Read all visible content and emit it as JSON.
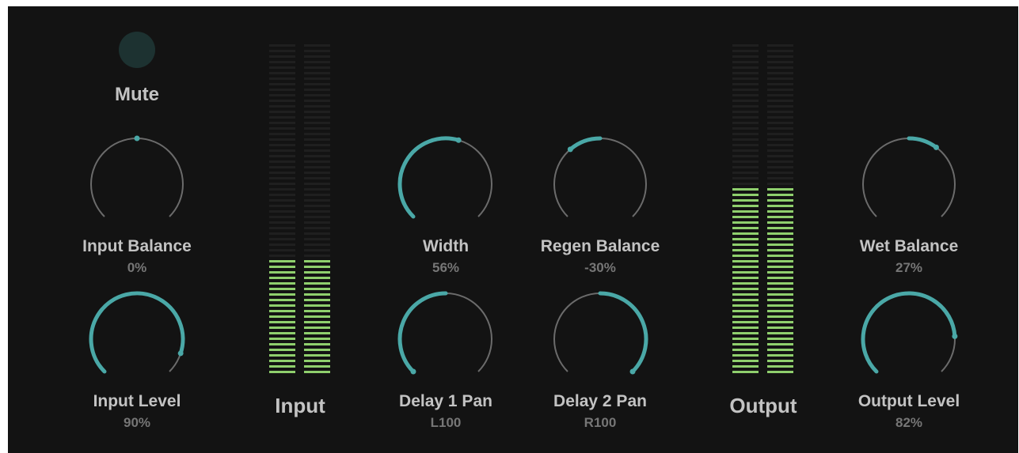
{
  "accent": "#4aa8a7",
  "track": "#6b6b6b",
  "meter_on": "#8fcf6d",
  "meter_off": "#1f1f1f",
  "mute": {
    "label": "Mute"
  },
  "meters": {
    "input": {
      "label": "Input",
      "level": 0.35
    },
    "output": {
      "label": "Output",
      "level": 0.56
    }
  },
  "knobs": [
    {
      "id": "input-balance",
      "label": "Input Balance",
      "value": "0%",
      "mode": "bipolar",
      "amount": 0.0
    },
    {
      "id": "input-level",
      "label": "Input Level",
      "value": "90%",
      "mode": "unipolar",
      "amount": 0.9
    },
    {
      "id": "width",
      "label": "Width",
      "value": "56%",
      "mode": "unipolar",
      "amount": 0.56
    },
    {
      "id": "regen-balance",
      "label": "Regen Balance",
      "value": "-30%",
      "mode": "bipolar",
      "amount": -0.3
    },
    {
      "id": "delay-1-pan",
      "label": "Delay 1 Pan",
      "value": "L100",
      "mode": "bipolar",
      "amount": -1.0
    },
    {
      "id": "delay-2-pan",
      "label": "Delay 2 Pan",
      "value": "R100",
      "mode": "bipolar",
      "amount": 1.0
    },
    {
      "id": "wet-balance",
      "label": "Wet Balance",
      "value": "27%",
      "mode": "bipolar",
      "amount": 0.27
    },
    {
      "id": "output-level",
      "label": "Output Level",
      "value": "82%",
      "mode": "unipolar",
      "amount": 0.82
    }
  ]
}
